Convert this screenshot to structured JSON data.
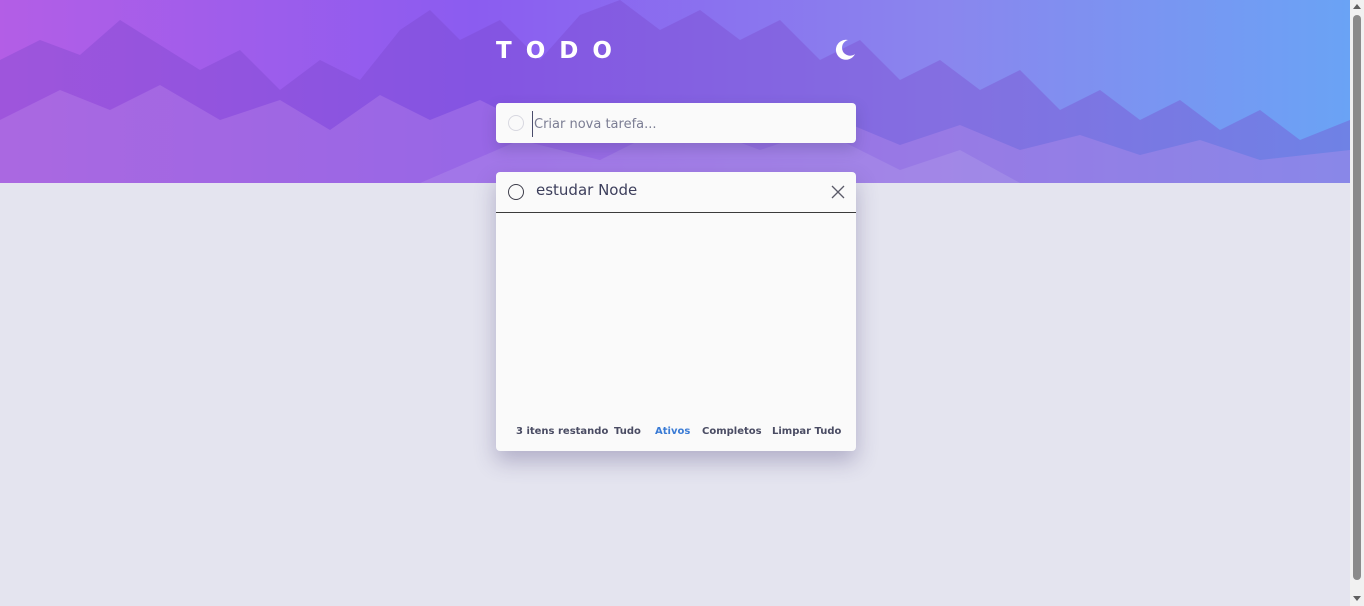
{
  "header": {
    "title": "TODO",
    "theme_icon": "moon-icon"
  },
  "new_todo": {
    "placeholder": "Criar nova tarefa...",
    "value": ""
  },
  "todos": [
    {
      "text": "estudar Node",
      "completed": false
    }
  ],
  "footer": {
    "items_left": "3 itens restando",
    "filters": [
      "Tudo",
      "Ativos",
      "Completos"
    ],
    "active_filter": "Ativos",
    "clear_label": "Limpar Tudo"
  },
  "colors": {
    "accent": "#3a7bd5",
    "background": "#e4e4ef",
    "card": "#fafafa",
    "text": "#494c6b",
    "gradient_start": "#b35ee6",
    "gradient_end": "#6aa3f5"
  }
}
